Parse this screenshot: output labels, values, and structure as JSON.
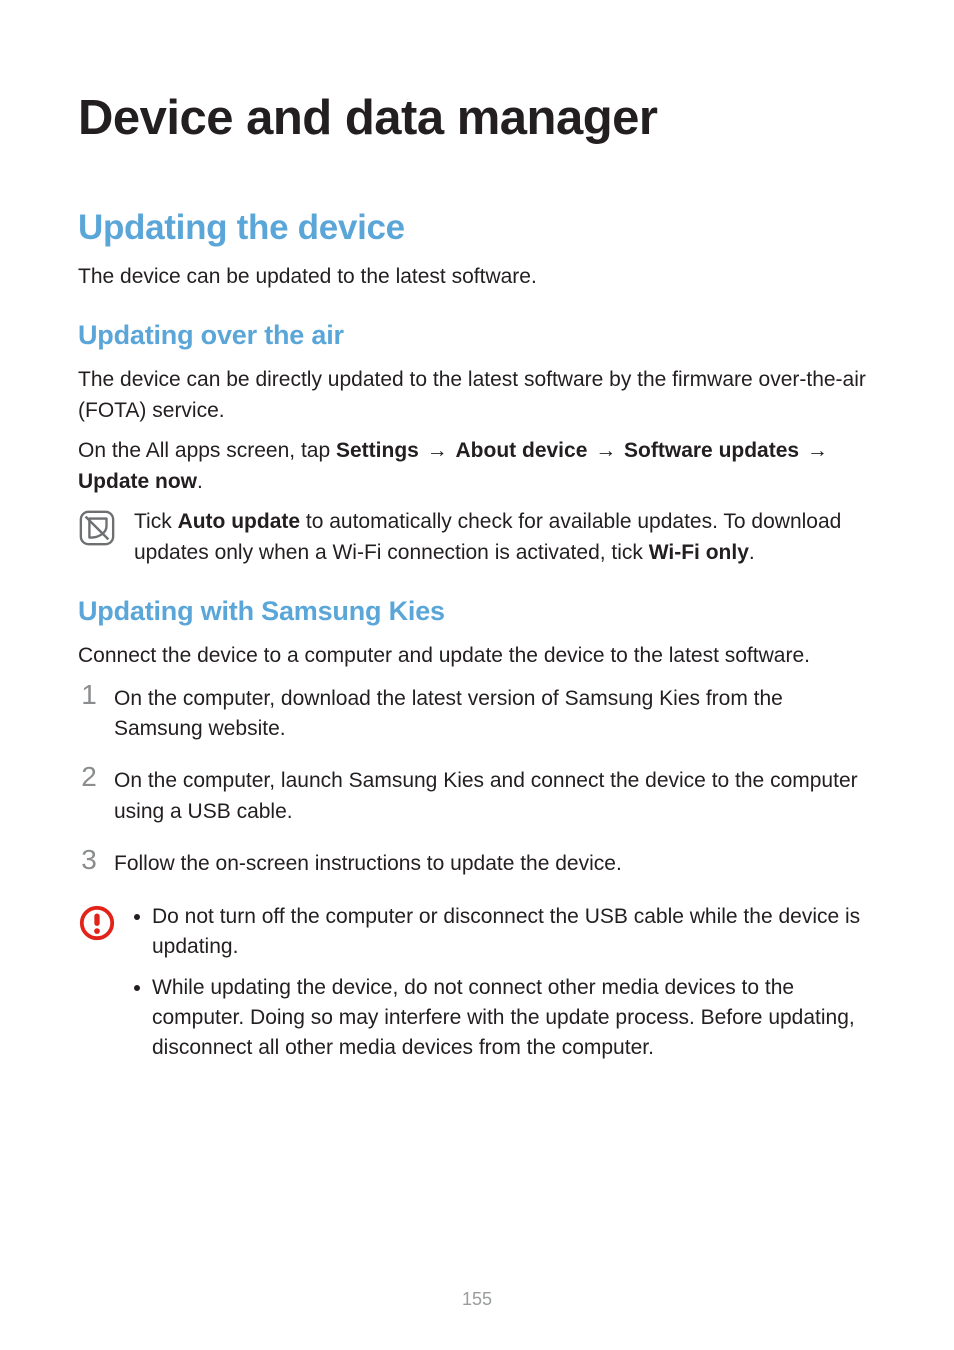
{
  "page_number": "155",
  "title": "Device and data manager",
  "section1": {
    "heading": "Updating the device",
    "intro": "The device can be updated to the latest software.",
    "sub1": {
      "heading": "Updating over the air",
      "p1": "The device can be directly updated to the latest software by the firmware over-the-air (FOTA) service.",
      "p2_parts": {
        "t1": "On the All apps screen, tap ",
        "b1": "Settings",
        "arrow": " → ",
        "b2": "About device",
        "b3": "Software updates",
        "b4": "Update now",
        "end": "."
      },
      "note_parts": {
        "t1": "Tick ",
        "b1": "Auto update",
        "t2": " to automatically check for available updates. To download updates only when a Wi-Fi connection is activated, tick ",
        "b2": "Wi-Fi only",
        "end": "."
      }
    },
    "sub2": {
      "heading": "Updating with Samsung Kies",
      "intro": "Connect the device to a computer and update the device to the latest software.",
      "steps": [
        "On the computer, download the latest version of Samsung Kies from the Samsung website.",
        "On the computer, launch Samsung Kies and connect the device to the computer using a USB cable.",
        "Follow the on-screen instructions to update the device."
      ],
      "step_nums": [
        "1",
        "2",
        "3"
      ],
      "cautions": [
        "Do not turn off the computer or disconnect the USB cable while the device is updating.",
        "While updating the device, do not connect other media devices to the computer. Doing so may interfere with the update process. Before updating, disconnect all other media devices from the computer."
      ]
    }
  }
}
